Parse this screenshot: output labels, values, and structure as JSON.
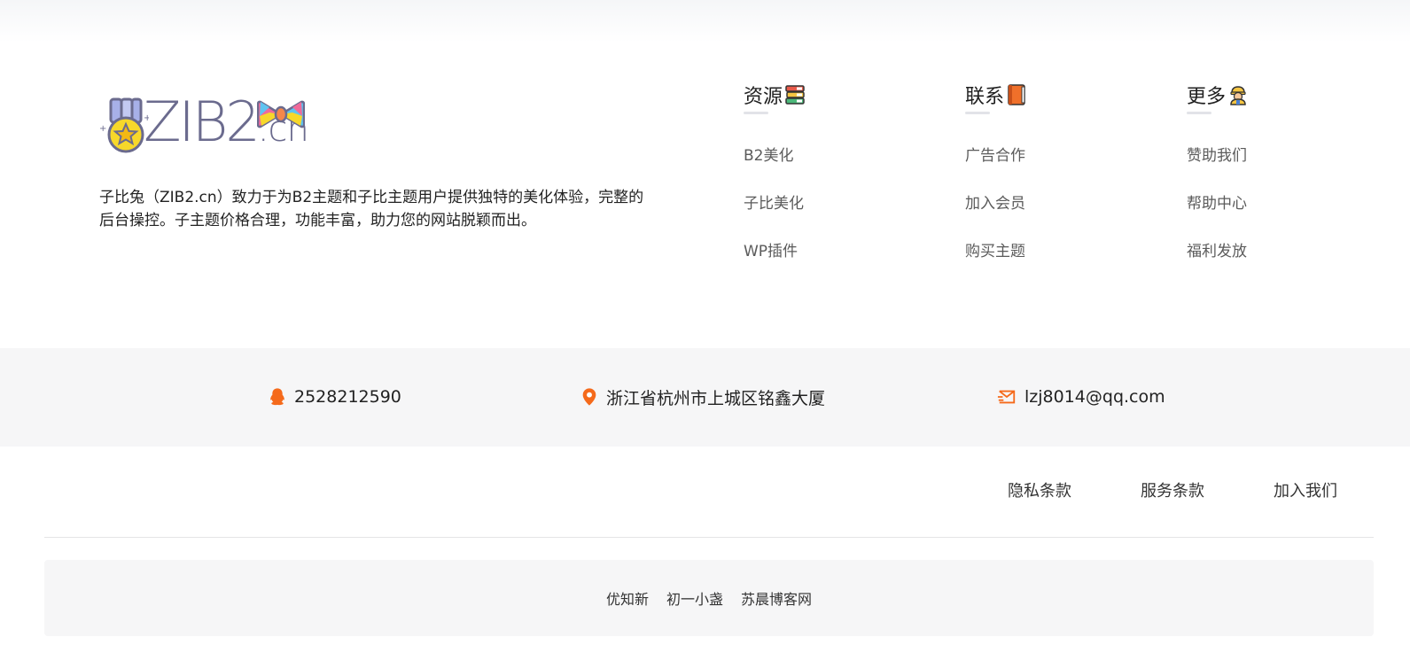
{
  "brand": {
    "logo_text": "ZIB2",
    "logo_suffix": ".cn",
    "description": "子比兔（ZIB2.cn）致力于为B2主题和子比主题用户提供独特的美化体验，完整的后台操控。子主题价格合理，功能丰富，助力您的网站脱颖而出。"
  },
  "columns": [
    {
      "title": "资源",
      "icon": "books-emoji-icon",
      "links": [
        "B2美化",
        "子比美化",
        "WP插件"
      ]
    },
    {
      "title": "联系",
      "icon": "orange-book-emoji-icon",
      "links": [
        "广告合作",
        "加入会员",
        "购买主题"
      ]
    },
    {
      "title": "更多",
      "icon": "worker-emoji-icon",
      "links": [
        "赞助我们",
        "帮助中心",
        "福利发放"
      ]
    }
  ],
  "contact": {
    "qq": "2528212590",
    "address": "浙江省杭州市上城区铭鑫大厦",
    "email": "lzj8014@qq.com",
    "accent_color": "#f56a1b"
  },
  "legal_links": [
    "隐私条款",
    "服务条款",
    "加入我们"
  ],
  "friend_links": [
    "优知新",
    "初一小盏",
    "苏晨博客网"
  ]
}
